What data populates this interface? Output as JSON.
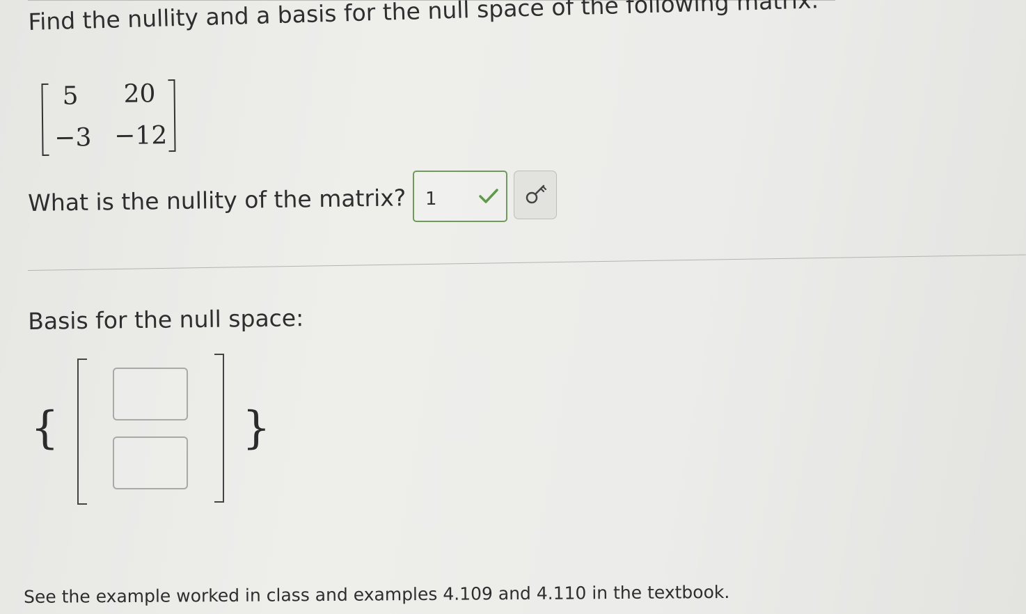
{
  "problem": {
    "prompt": "Find the nullity and a basis for the null space of the following matrix."
  },
  "matrix": {
    "rows": [
      [
        "5",
        "20"
      ],
      [
        "−3",
        "−12"
      ]
    ]
  },
  "nullity": {
    "question": "What is the nullity of the matrix?",
    "answer_value": "1",
    "status": "correct",
    "accent_color": "#5f9a4a"
  },
  "basis": {
    "label": "Basis for the null space:",
    "open_brace": "{",
    "close_brace": "}",
    "vector_entries": [
      "",
      ""
    ]
  },
  "icons": {
    "answer_key": "key-icon",
    "correct": "checkmark-icon"
  },
  "hint": {
    "text": "See the example worked in class and examples 4.109 and 4.110 in the textbook."
  }
}
